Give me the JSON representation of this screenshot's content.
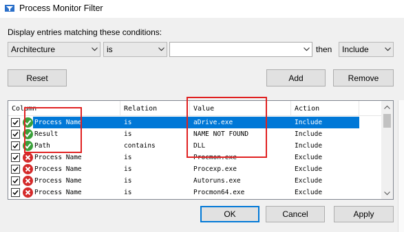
{
  "window": {
    "title": "Process Monitor Filter"
  },
  "conditions_label": "Display entries matching these conditions:",
  "filter": {
    "column": "Architecture",
    "relation": "is",
    "value": "",
    "then_label": "then",
    "action": "Include"
  },
  "buttons": {
    "reset": "Reset",
    "add": "Add",
    "remove": "Remove",
    "ok": "OK",
    "cancel": "Cancel",
    "apply": "Apply"
  },
  "list": {
    "headers": [
      "Column",
      "Relation",
      "Value",
      "Action"
    ],
    "rows": [
      {
        "column": "Process Name",
        "relation": "is",
        "value": "aDrive.exe",
        "action": "Include",
        "status": "include",
        "selected": true
      },
      {
        "column": "Result",
        "relation": "is",
        "value": "NAME NOT FOUND",
        "action": "Include",
        "status": "include",
        "selected": false
      },
      {
        "column": "Path",
        "relation": "contains",
        "value": "DLL",
        "action": "Include",
        "status": "include",
        "selected": false
      },
      {
        "column": "Process Name",
        "relation": "is",
        "value": "Procmon.exe",
        "action": "Exclude",
        "status": "exclude",
        "selected": false
      },
      {
        "column": "Process Name",
        "relation": "is",
        "value": "Procexp.exe",
        "action": "Exclude",
        "status": "exclude",
        "selected": false
      },
      {
        "column": "Process Name",
        "relation": "is",
        "value": "Autoruns.exe",
        "action": "Exclude",
        "status": "exclude",
        "selected": false
      },
      {
        "column": "Process Name",
        "relation": "is",
        "value": "Procmon64.exe",
        "action": "Exclude",
        "status": "exclude",
        "selected": false
      }
    ]
  },
  "colors": {
    "selection": "#0078d7",
    "include_icon": "#3aa03a",
    "exclude_icon": "#d42a2a",
    "annotation": "#e02020"
  },
  "icons": {
    "app": "filter-icon",
    "dropdown": "chevron-down-icon",
    "include": "checkmark-circle-icon",
    "exclude": "x-circle-icon"
  }
}
